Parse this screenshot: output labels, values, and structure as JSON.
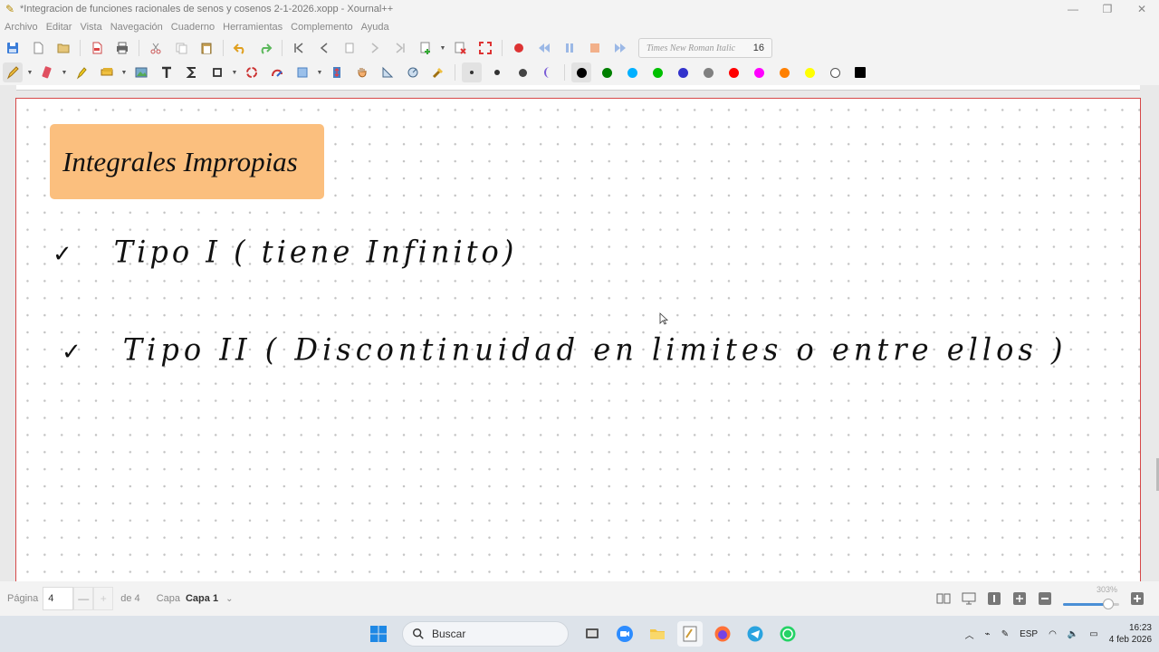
{
  "window": {
    "title": "*Integracion de funciones racionales de senos  y cosenos 2-1-2026.xopp - Xournal++",
    "controls": [
      "minimize",
      "maximize",
      "close"
    ]
  },
  "menu": [
    "Archivo",
    "Editar",
    "Vista",
    "Navegación",
    "Cuaderno",
    "Herramientas",
    "Complemento",
    "Ayuda"
  ],
  "toolbar": {
    "font_name": "Times New Roman Italic",
    "font_size": "16",
    "pen_colors": [
      "#000000",
      "#008000",
      "#00b0ff",
      "#00c000",
      "#3333cc",
      "#808080",
      "#ff0000",
      "#ff00ff",
      "#ff8000",
      "#ffff00",
      "#ffffff"
    ],
    "current_color": "#000000"
  },
  "document": {
    "title_box": "Integrales Impropias",
    "title_box_color": "#fbbf7e",
    "lines": [
      {
        "check": "✓",
        "text": "Tipo I ( tiene Infinito)"
      },
      {
        "check": "✓",
        "text": "Tipo II ( Discontinuidad en limites o entre ellos )"
      }
    ]
  },
  "statusbar": {
    "page_label": "Página",
    "page_value": "4",
    "prev_label": "—",
    "next_label": "+",
    "page_total": "de 4",
    "layer_label": "Capa",
    "layer_value": "Capa 1",
    "layer_caret": "⌄",
    "zoom_label": "303%",
    "zoom_level": 0.8
  },
  "taskbar": {
    "search_placeholder": "Buscar",
    "language": "ESP",
    "time": "16:23",
    "date": "4 feb 2026"
  }
}
